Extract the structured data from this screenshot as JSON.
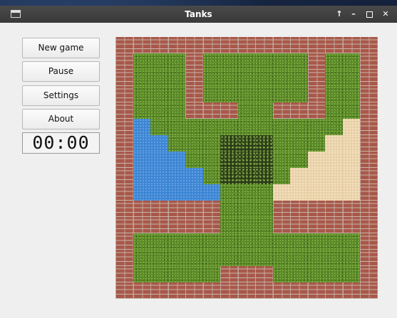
{
  "window": {
    "title": "Tanks"
  },
  "titlebar_controls": [
    "keep-above",
    "minimize",
    "maximize",
    "close"
  ],
  "menu": {
    "new_game": "New game",
    "pause": "Pause",
    "settings": "Settings",
    "about": "About"
  },
  "timer": {
    "display": "00:00"
  },
  "map": {
    "legend": {
      "B": "brick",
      "G": "grass",
      "W": "water",
      "S": "sand",
      "F": "bush"
    },
    "rows": [
      "BBBBBBBBBBBBBBB",
      "BGGGBGGGGGGBGGB",
      "BGGGBGGGGGGBGGB",
      "BGGGBGGGGGGBGGB",
      "BGGGBBBGGBBBGGB",
      "BWGGGGGGGGGGGSB",
      "BWWGGGFFFGGGSSB",
      "BWWWGGFFFGGSSSB",
      "BWWWWGFFFGSSSSB",
      "BWWWWWGGGSSSSSB",
      "BBBBBBGGGBBBBBB",
      "BBBBBBGGGBBBBBB",
      "BGGGGGGGGGGGGGB",
      "BGGGGGGGGGGGGGB",
      "BGGGGGBBBGGGGGB",
      "BBBBBBBBBBBBBBB"
    ]
  }
}
